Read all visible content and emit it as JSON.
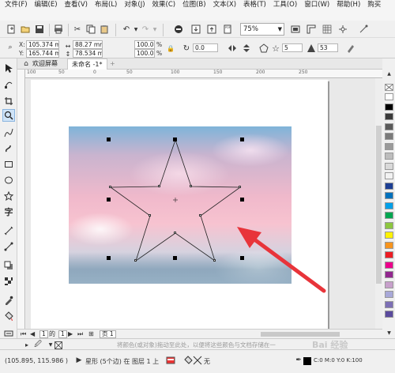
{
  "menu": [
    "文件(F)",
    "编辑(E)",
    "查看(V)",
    "布局(L)",
    "对象(J)",
    "效果(C)",
    "位图(B)",
    "文本(X)",
    "表格(T)",
    "工具(O)",
    "窗口(W)",
    "帮助(H)",
    "购买"
  ],
  "toolbar": {
    "zoom": "75%"
  },
  "property_bar": {
    "x_label": "X:",
    "x_value": "105.374 mm",
    "y_label": "Y:",
    "y_value": "165.744 mm",
    "w_value": "88.27 mm",
    "h_value": "78.534 mm",
    "scale_w": "100.0",
    "scale_h": "100.0",
    "percent": "%",
    "rotation": "0.0",
    "points": "5",
    "sharpness": "53"
  },
  "tabs": {
    "welcome": "欢迎屏幕",
    "document": "未命名 -1*",
    "add": "+"
  },
  "ruler": {
    "ticks": [
      "100",
      "50",
      "0",
      "50",
      "100",
      "150",
      "200",
      "250"
    ]
  },
  "page_nav": {
    "current": "1",
    "of": "的",
    "total": "1",
    "page_label": "页 1"
  },
  "hint": "将颜色(或对象)拖动至此处，以便将这些颜色与文档存储在一",
  "status": {
    "coords": "(105.895, 115.986 )",
    "object_info": "星形 (5个边) 在 图层 1 上",
    "fill_none": "无",
    "outline_info": "C:0 M:0 Y:0 K:100"
  },
  "watermark": "Bai 经验",
  "palette_colors": [
    "#ffffff",
    "#000000",
    "#3a3a3a",
    "#5a5a5a",
    "#7a7a7a",
    "#9a9a9a",
    "#bdbdbd",
    "#d9d9d9",
    "#f2f2f2",
    "#1c3f94",
    "#0071bc",
    "#00a0e9",
    "#00a650",
    "#8dc63f",
    "#fff200",
    "#f7941d",
    "#ed1c24",
    "#ec008c",
    "#92278f",
    "#c7a0cb",
    "#a8a8d8",
    "#7d6fb5",
    "#5b4b9e"
  ],
  "accent_colors": {
    "arrow": "#e8343a",
    "selected_tool": "#cfe3f7"
  }
}
